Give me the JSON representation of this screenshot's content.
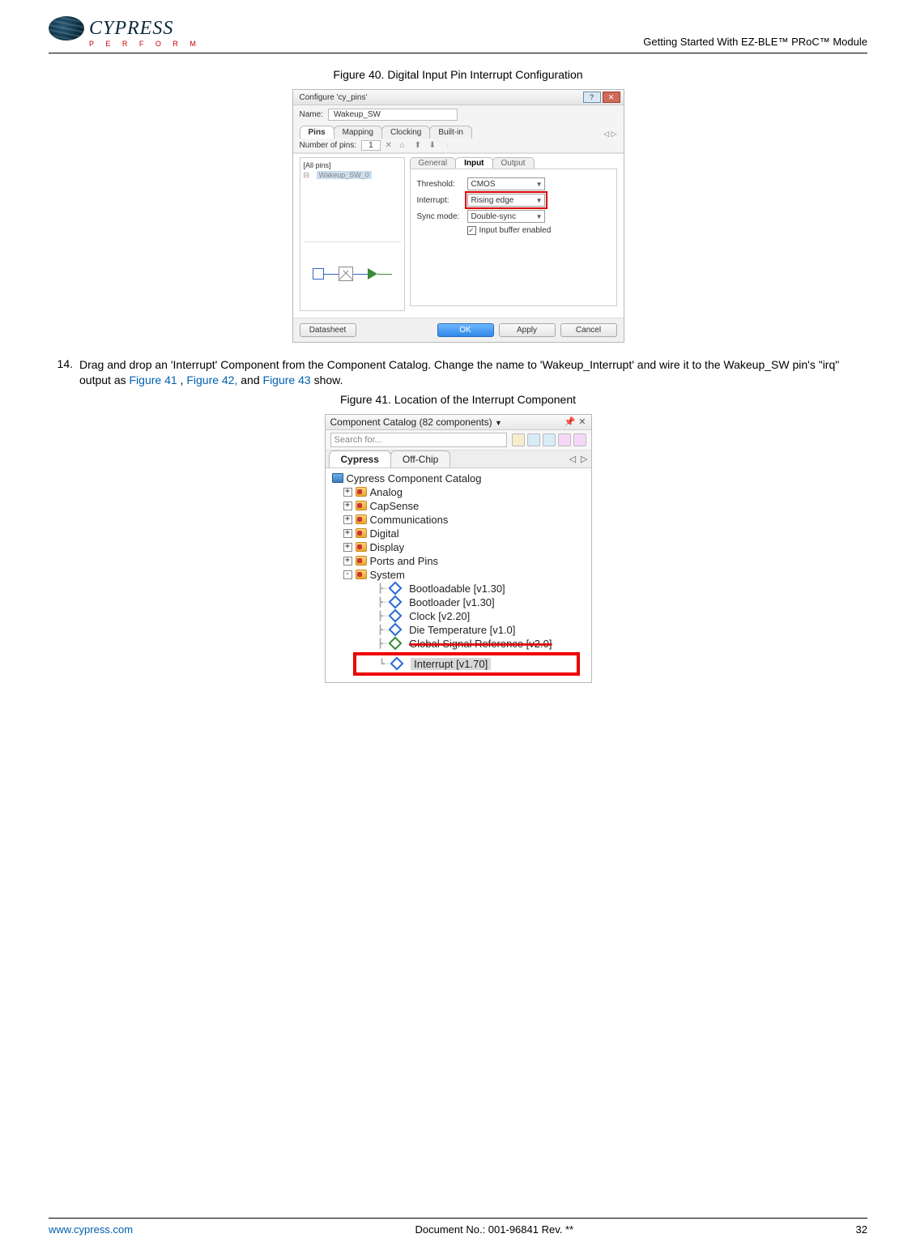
{
  "header": {
    "logo_text": "CYPRESS",
    "logo_sub": "P E R F O R M",
    "doc_title": "Getting Started With EZ-BLE™ PRoC™ Module"
  },
  "figure40": {
    "caption": "Figure 40. Digital Input Pin Interrupt Configuration",
    "window_title": "Configure 'cy_pins'",
    "name_label": "Name:",
    "name_value": "Wakeup_SW",
    "tabs": [
      "Pins",
      "Mapping",
      "Clocking",
      "Built-in"
    ],
    "active_tab": "Pins",
    "pincount_label": "Number of pins:",
    "pincount_value": "1",
    "tree_root": "[All pins]",
    "tree_item": "Wakeup_SW_0",
    "subtabs": [
      "General",
      "Input",
      "Output"
    ],
    "active_subtab": "Input",
    "threshold_label": "Threshold:",
    "threshold_value": "CMOS",
    "interrupt_label": "Interrupt:",
    "interrupt_value": "Rising edge",
    "sync_label": "Sync mode:",
    "sync_value": "Double-sync",
    "buffer_label": "Input buffer enabled",
    "btn_datasheet": "Datasheet",
    "btn_ok": "OK",
    "btn_apply": "Apply",
    "btn_cancel": "Cancel"
  },
  "step14": {
    "num": "14.",
    "text_a": "Drag and drop an 'Interrupt' Component from the Component Catalog. Change the name to 'Wakeup_Interrupt' and wire it to the Wakeup_SW pin's \"irq\" output as ",
    "link1": "Figure 41",
    "sep1": " , ",
    "link2": "Figure 42,",
    "sep2": " and ",
    "link3": "Figure 43",
    "text_b": " show."
  },
  "figure41": {
    "caption": "Figure 41. Location of the Interrupt Component",
    "panel_title": "Component Catalog (82 components)",
    "search_placeholder": "Search for...",
    "tabs": [
      "Cypress",
      "Off-Chip"
    ],
    "active_tab": "Cypress",
    "root": "Cypress Component Catalog",
    "folders": [
      "Analog",
      "CapSense",
      "Communications",
      "Digital",
      "Display",
      "Ports and Pins",
      "System"
    ],
    "system_children": [
      "Bootloadable [v1.30]",
      "Bootloader [v1.30]",
      "Clock [v2.20]",
      "Die Temperature [v1.0]",
      "Global Signal Reference [v2.0]",
      "Interrupt [v1.70]"
    ]
  },
  "footer": {
    "url": "www.cypress.com",
    "docno": "Document No.: 001-96841 Rev. **",
    "page": "32"
  }
}
